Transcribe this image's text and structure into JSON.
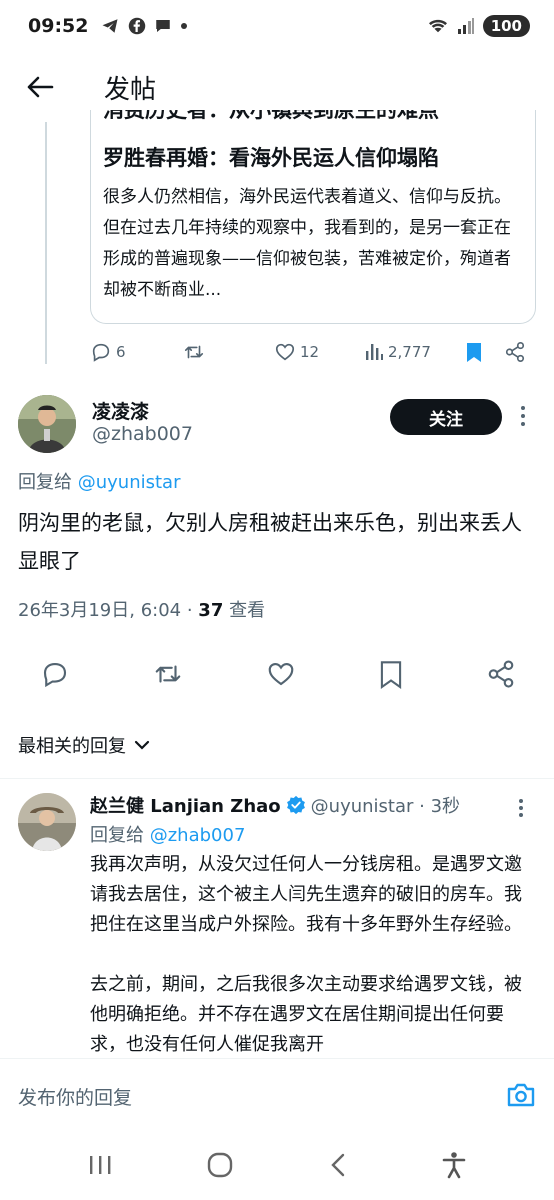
{
  "status_bar": {
    "time": "09:52",
    "battery": "100"
  },
  "header": {
    "title": "发帖"
  },
  "quote": {
    "cut_title": "消费历史者：从小镇舆到原生的难点",
    "title": "罗胜春再婚：看海外民运人信仰塌陷",
    "body": "很多人仍然相信，海外民运代表着道义、信仰与反抗。但在过去几年持续的观察中，我看到的，是另一套正在形成的普遍现象——信仰被包装，苦难被定价，殉道者却被不断商业..."
  },
  "parent_actions": {
    "replies": "6",
    "likes": "12",
    "views": "2,777"
  },
  "tweet": {
    "author_name": "凌凌漆",
    "author_handle": "@zhab007",
    "follow_label": "关注",
    "reply_prefix": "回复给",
    "reply_handle": "@uyunistar",
    "text": "阴沟里的老鼠，欠别人房租被赶出来乐色，别出来丢人显眼了",
    "timestamp": "26年3月19日, 6:04 · ",
    "views_count": "37",
    "views_label": " 查看"
  },
  "sort": {
    "label": "最相关的回复"
  },
  "reply": {
    "author_name": "赵兰健 Lanjian Zhao",
    "author_handle": "@uyunistar · 3秒",
    "reply_prefix": "回复给",
    "reply_handle": "@zhab007",
    "paragraph1": "我再次声明，从没欠过任何人一分钱房租。是遇罗文邀请我去居住，这个被主人闫先生遗弃的破旧的房车。我把住在这里当成户外探险。我有十多年野外生存经验。",
    "paragraph2": "去之前，期间，之后我很多次主动要求给遇罗文钱，被他明确拒绝。并不存在遇罗文在居住期间提出任何要求，也没有任何人催促我离开"
  },
  "compose": {
    "placeholder": "发布你的回复"
  },
  "colors": {
    "accent": "#1d9bf0",
    "text": "#0f1419",
    "secondary": "#536471",
    "border": "#cfd9de"
  }
}
